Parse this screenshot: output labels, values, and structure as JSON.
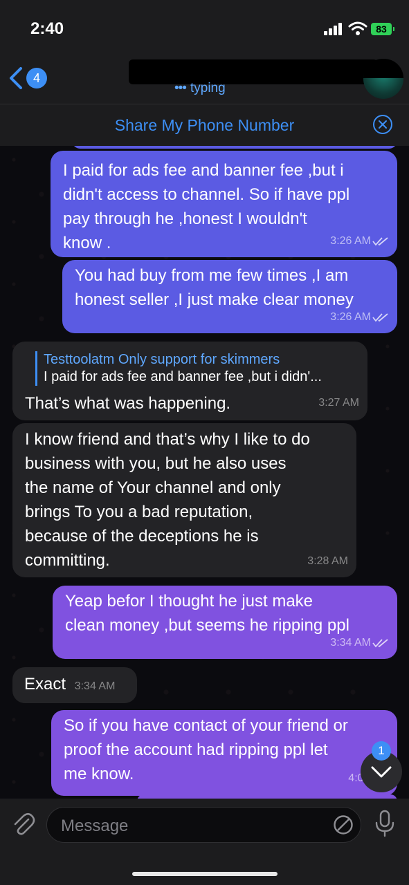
{
  "status_bar": {
    "time": "2:40",
    "battery": "83"
  },
  "header": {
    "unread_count": "4",
    "subtitle": "typing"
  },
  "pinned": {
    "label": "Share My Phone Number"
  },
  "messages": [
    {
      "dir": "out",
      "text": "I paid for ads fee and banner fee ,but i\ndidn't access to channel. So if have ppl\npay through he ,honest I wouldn't\nknow .",
      "time": "3:26 AM"
    },
    {
      "dir": "out",
      "text": "You had buy from me few times ,I am\nhonest seller ,I just make clear money",
      "time": "3:26 AM"
    },
    {
      "dir": "in",
      "reply_name": "Testtoolatm Only support for skimmers",
      "reply_text": "I paid for ads fee and banner fee ,but i didn'...",
      "text": "That’s what was happening.",
      "time": "3:27 AM"
    },
    {
      "dir": "in",
      "text": "I know friend and that’s why I like to do\nbusiness with you, but he also uses\nthe name of Your channel and only\nbrings To you a bad reputation,\nbecause of the deceptions he is\ncommitting.",
      "time": "3:28 AM"
    },
    {
      "dir": "out",
      "text": "Yeap befor I thought he just make\nclean money ,but seems he ripping ppl",
      "time": "3:34 AM"
    },
    {
      "dir": "in",
      "text": "Exact",
      "time": "3:34 AM"
    },
    {
      "dir": "out",
      "text": "So if you have contact of your friend or\nproof the account had  ripping ppl let\nme know.",
      "time": "4:07 AM"
    }
  ],
  "scroll_badge": "1",
  "composer": {
    "placeholder": "Message"
  },
  "colors": {
    "accent": "#3d8ff5",
    "outgoing_blue": "#5b5be3",
    "outgoing_purple": "#8052e0",
    "incoming": "#232326"
  }
}
